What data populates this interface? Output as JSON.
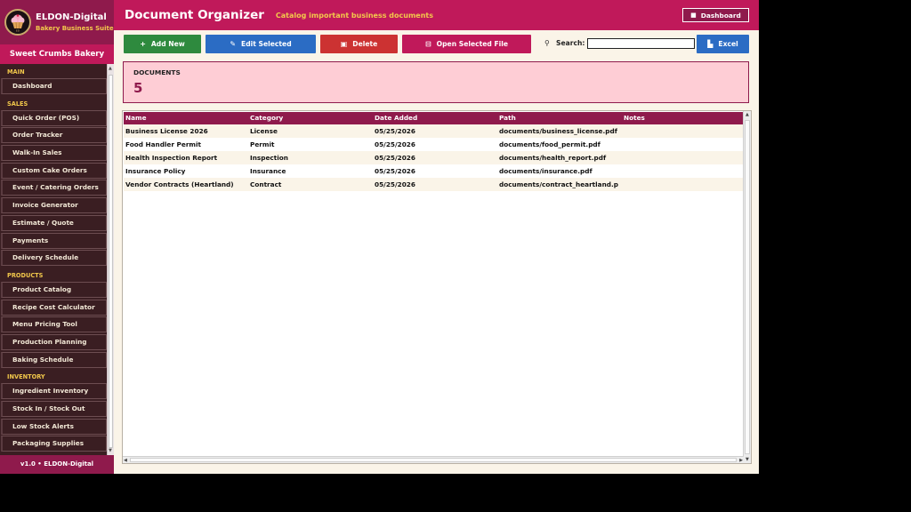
{
  "app": {
    "brand_name": "ELDON-Digital",
    "brand_subtitle": "Bakery Business Suite",
    "logo_badge": "ED",
    "store_name": "Sweet Crumbs Bakery",
    "version_text": "v1.0  •  ELDON-Digital"
  },
  "sidebar": {
    "sections": [
      {
        "title": "MAIN",
        "items": [
          "Dashboard"
        ]
      },
      {
        "title": "SALES",
        "items": [
          "Quick Order (POS)",
          "Order Tracker",
          "Walk-In Sales",
          "Custom Cake Orders",
          "Event / Catering Orders",
          "Invoice Generator",
          "Estimate / Quote",
          "Payments",
          "Delivery Schedule"
        ]
      },
      {
        "title": "PRODUCTS",
        "items": [
          "Product Catalog",
          "Recipe Cost Calculator",
          "Menu Pricing Tool",
          "Production Planning",
          "Baking Schedule"
        ]
      },
      {
        "title": "INVENTORY",
        "items": [
          "Ingredient Inventory",
          "Stock In / Stock Out",
          "Low Stock Alerts",
          "Packaging Supplies"
        ]
      }
    ]
  },
  "header": {
    "title": "Document Organizer",
    "subtitle": "Catalog important business documents",
    "dashboard_button": "Dashboard"
  },
  "toolbar": {
    "add_label": "Add New",
    "edit_label": "Edit Selected",
    "delete_label": "Delete",
    "open_label": "Open Selected File",
    "search_label": "Search:",
    "search_value": "",
    "excel_label": "Excel"
  },
  "summary": {
    "label": "DOCUMENTS",
    "count": "5"
  },
  "table": {
    "columns": [
      "Name",
      "Category",
      "Date Added",
      "Path",
      "Notes"
    ],
    "rows": [
      [
        "Business License 2026",
        "License",
        "05/25/2026",
        "documents/business_license.pdf",
        ""
      ],
      [
        "Food Handler Permit",
        "Permit",
        "05/25/2026",
        "documents/food_permit.pdf",
        ""
      ],
      [
        "Health Inspection Report",
        "Inspection",
        "05/25/2026",
        "documents/health_report.pdf",
        ""
      ],
      [
        "Insurance Policy",
        "Insurance",
        "05/25/2026",
        "documents/insurance.pdf",
        ""
      ],
      [
        "Vendor Contracts (Heartland)",
        "Contract",
        "05/25/2026",
        "documents/contract_heartland.p",
        ""
      ]
    ]
  },
  "colors": {
    "brand": "#c0195a",
    "brand_dark": "#8f1a4c",
    "sidebar_bg": "#3a1e22",
    "accent_gold": "#f2c84b",
    "add_green": "#2e8a3e",
    "edit_blue": "#2b6cc4",
    "delete_red": "#cc3232",
    "open_pink": "#c0195a",
    "excel_blue": "#2b6cc4"
  }
}
